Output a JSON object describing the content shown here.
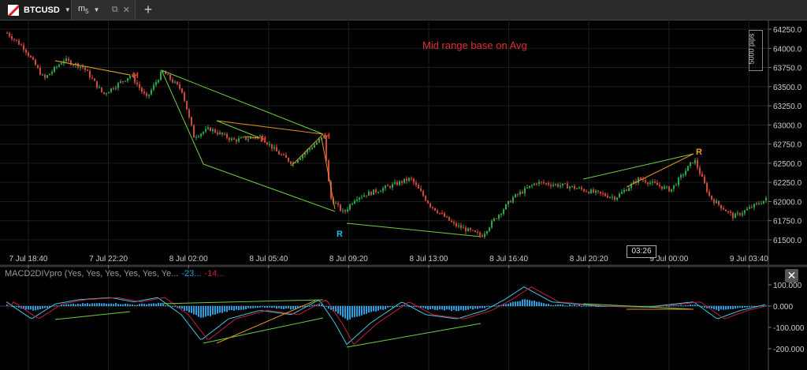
{
  "tabbar": {
    "symbol": "BTCUSD",
    "timeframe": "m",
    "timeframe_sub": "5"
  },
  "chart": {
    "title": "Mid range base on Avg",
    "pips_label": "5000 pips",
    "price_ticks": [
      "64250.0",
      "64000.0",
      "63750.0",
      "63500.0",
      "63250.0",
      "63000.0",
      "62750.0",
      "62500.0",
      "62250.0",
      "62000.0",
      "61750.0",
      "61500.0"
    ],
    "time_ticks": [
      "7 Jul 18:40",
      "7 Jul 22:20",
      "8 Jul 02:00",
      "8 Jul 05:40",
      "8 Jul 09:20",
      "8 Jul 13:00",
      "8 Jul 16:40",
      "8 Jul 20:20",
      "9 Jul 00:00",
      "9 Jul 03:40"
    ],
    "cursor_time": "03:26",
    "markers": [
      {
        "label": "H",
        "color": "#e84020"
      },
      {
        "label": "H",
        "color": "#e84020"
      },
      {
        "label": "H",
        "color": "#e84020"
      },
      {
        "label": "R",
        "color": "#20c0e0"
      },
      {
        "label": "R",
        "color": "#e8a020"
      }
    ]
  },
  "indicator": {
    "name": "MACD2DIVpro (Yes, Yes, Yes, Yes, Yes, Ye...",
    "value1": "-23...",
    "value2": "-14...",
    "ticks": [
      "100.000",
      "0.000",
      "-100.000",
      "-200.000"
    ],
    "close_label": "✕"
  }
}
